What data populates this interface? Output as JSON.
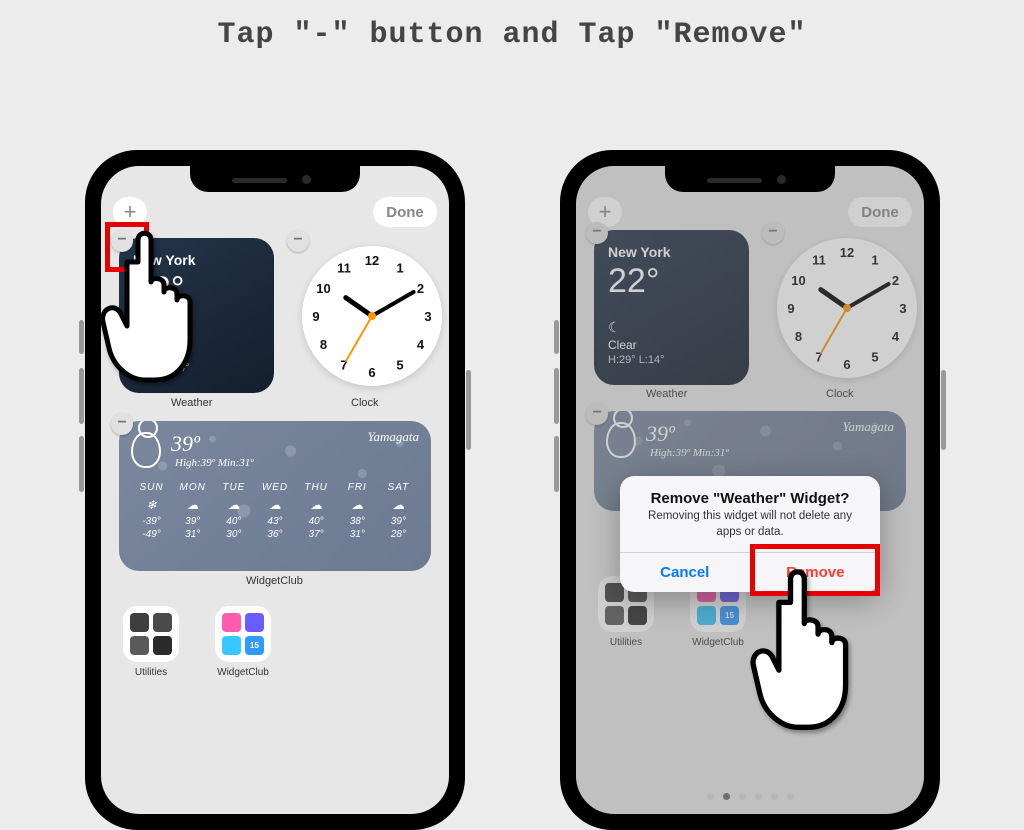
{
  "title": "Tap \"-\" button and Tap  \"Remove\"",
  "toolbar": {
    "add": "+",
    "done": "Done"
  },
  "widgets": {
    "weather": {
      "city": "New York",
      "temp": "22°",
      "icon": "☾",
      "condition": "Clear",
      "range": "H:29° L:14°",
      "label": "Weather"
    },
    "clock": {
      "label": "Clock",
      "hour": 10,
      "minute": 10,
      "second": 35,
      "numerals": [
        "12",
        "1",
        "2",
        "3",
        "4",
        "5",
        "6",
        "7",
        "8",
        "9",
        "10",
        "11"
      ]
    },
    "forecast": {
      "label": "WidgetClub",
      "temp": "39º",
      "hilo": "High:39º Min:31º",
      "location": "Yamagata",
      "days": [
        {
          "d": "SUN",
          "i": "❄︎",
          "hi": "-39°",
          "lo": "-49°"
        },
        {
          "d": "MON",
          "i": "☁︎",
          "hi": "39°",
          "lo": "31°"
        },
        {
          "d": "TUE",
          "i": "☁︎",
          "hi": "40°",
          "lo": "30°"
        },
        {
          "d": "WED",
          "i": "☁︎",
          "hi": "43°",
          "lo": "36°"
        },
        {
          "d": "THU",
          "i": "☁︎",
          "hi": "40°",
          "lo": "37°"
        },
        {
          "d": "FRI",
          "i": "☁︎",
          "hi": "38°",
          "lo": "31°"
        },
        {
          "d": "SAT",
          "i": "☁︎",
          "hi": "39°",
          "lo": "28°"
        }
      ]
    }
  },
  "folders": [
    {
      "name": "Utilities",
      "icons": [
        "#3e3e3e",
        "#4a4a4a",
        "#5a5a5a",
        "#2b2b2b"
      ]
    },
    {
      "name": "WidgetClub",
      "icons": [
        "#ff5ab0",
        "#6a5cff",
        "#38c7ff",
        "#2e9bff"
      ],
      "badge": "15"
    }
  ],
  "alert": {
    "title": "Remove \"Weather\" Widget?",
    "message": "Removing this widget will not delete any apps or data.",
    "cancel": "Cancel",
    "remove": "Remove"
  },
  "pager": {
    "count": 6,
    "active": 1
  },
  "highlight_color": "#e60000"
}
